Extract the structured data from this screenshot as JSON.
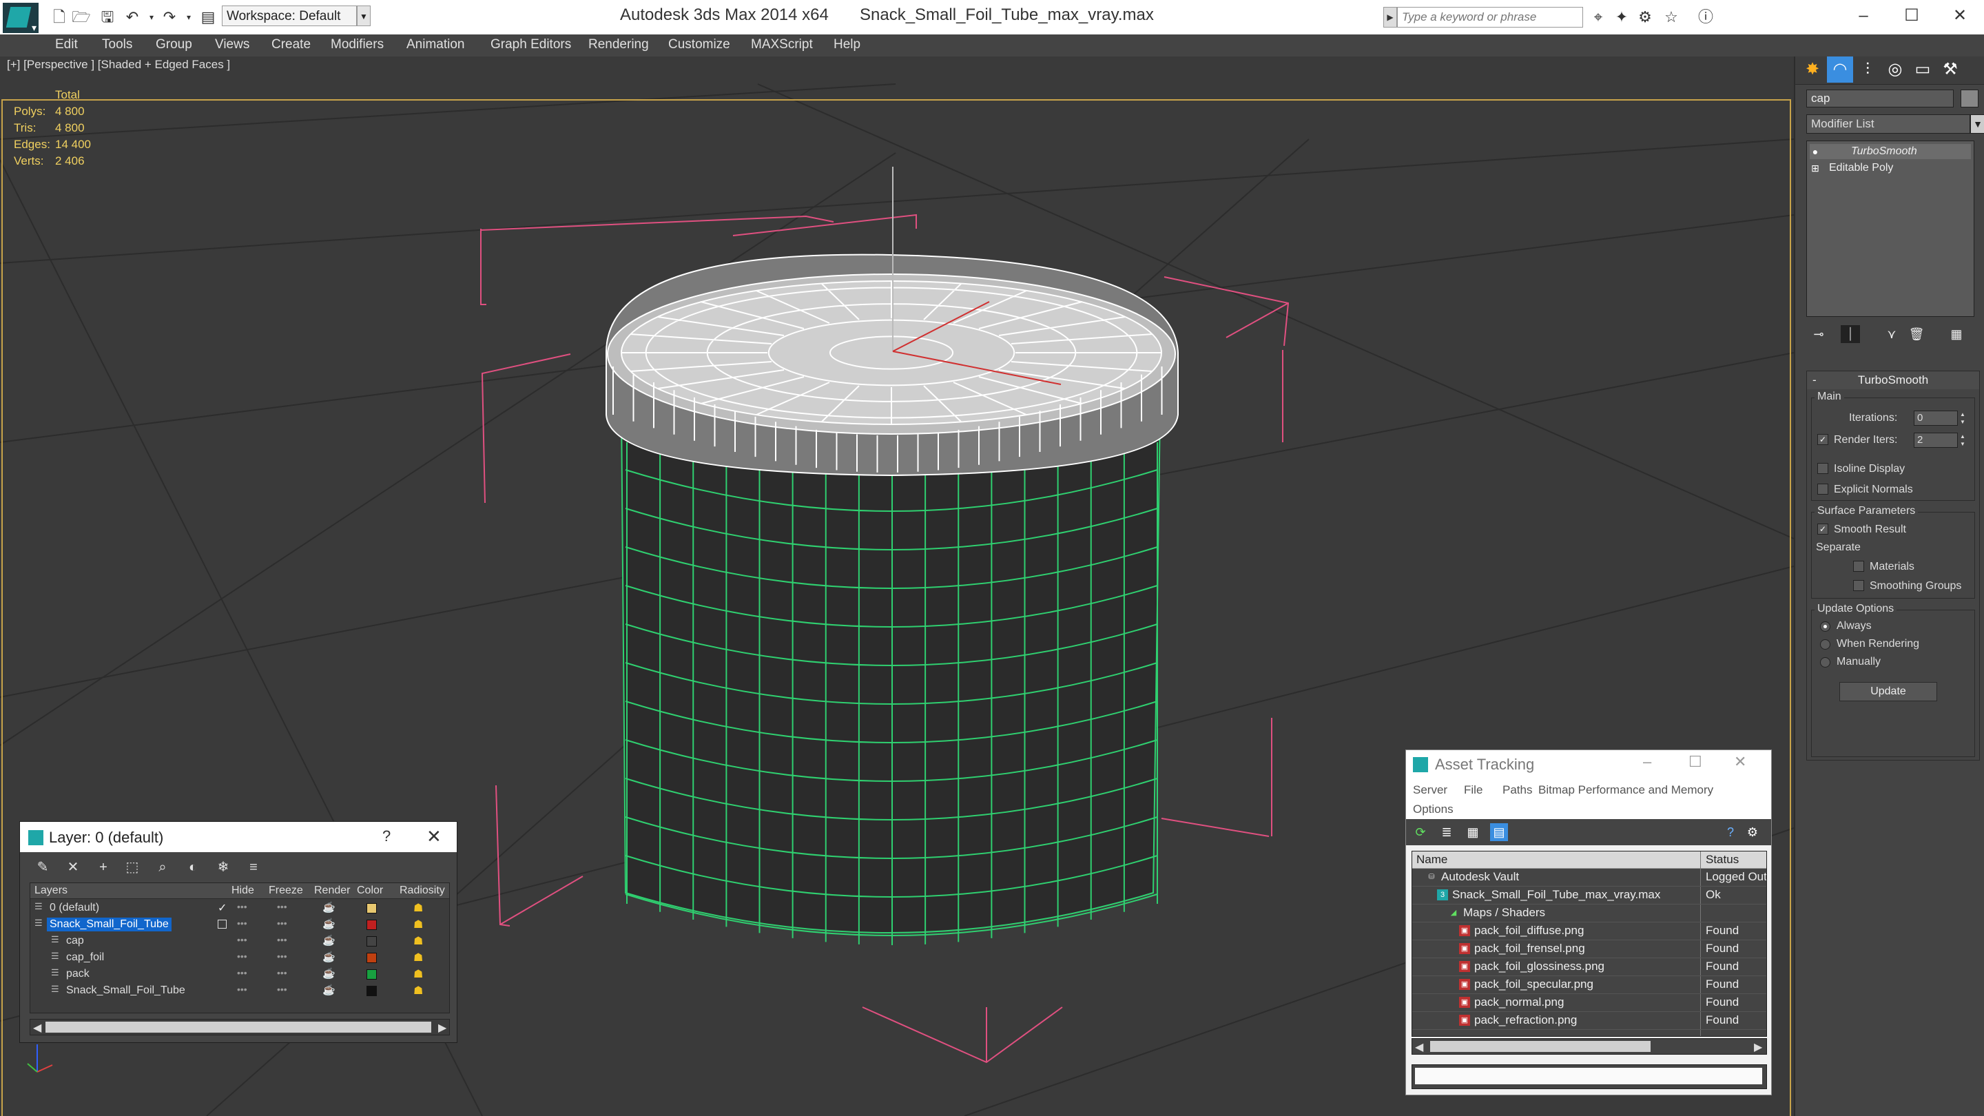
{
  "titlebar": {
    "workspace": "Workspace: Default",
    "app_title": "Autodesk 3ds Max  2014 x64",
    "file_title": "Snack_Small_Foil_Tube_max_vray.max",
    "search_placeholder": "Type a keyword or phrase"
  },
  "menu": [
    "Edit",
    "Tools",
    "Group",
    "Views",
    "Create",
    "Modifiers",
    "Animation",
    "Graph Editors",
    "Rendering",
    "Customize",
    "MAXScript",
    "Help"
  ],
  "viewport": {
    "label": "[+] [Perspective ] [Shaded + Edged Faces ]",
    "stats_header": "Total",
    "stats": [
      {
        "label": "Polys:",
        "value": "4 800"
      },
      {
        "label": "Tris:",
        "value": "4 800"
      },
      {
        "label": "Edges:",
        "value": "14 400"
      },
      {
        "label": "Verts:",
        "value": "2 406"
      }
    ],
    "colors": {
      "wire": "#ffffff",
      "body_wire": "#2fd070",
      "gizmo": "#e05080",
      "frame": "#c8a34a"
    }
  },
  "command_panel": {
    "object_name": "cap",
    "modifier_list": "Modifier List",
    "stack": [
      "TurboSmooth",
      "Editable Poly"
    ],
    "turbosmooth": {
      "title": "TurboSmooth",
      "main_group": "Main",
      "iterations_label": "Iterations:",
      "iterations": "0",
      "render_iters_label": "Render Iters:",
      "render_iters": "2",
      "isoline": "Isoline Display",
      "explicit_normals": "Explicit Normals",
      "surface_group": "Surface Parameters",
      "smooth_result": "Smooth Result",
      "separate": "Separate",
      "materials": "Materials",
      "smoothing_groups": "Smoothing Groups",
      "update_group": "Update Options",
      "always": "Always",
      "when_rendering": "When Rendering",
      "manually": "Manually",
      "update_button": "Update"
    }
  },
  "layer_dialog": {
    "title": "Layer: 0 (default)",
    "help": "?",
    "columns": [
      "Layers",
      "Hide",
      "Freeze",
      "Render",
      "Color",
      "Radiosity"
    ],
    "rows": [
      {
        "name": "0 (default)",
        "color": "#e8c870",
        "indent": 0
      },
      {
        "name": "Snack_Small_Foil_Tube",
        "color": "#c02020",
        "indent": 0,
        "selected": true
      },
      {
        "name": "cap",
        "color": "#444444",
        "indent": 1
      },
      {
        "name": "cap_foil",
        "color": "#c04010",
        "indent": 1
      },
      {
        "name": "pack",
        "color": "#18a040",
        "indent": 1
      },
      {
        "name": "Snack_Small_Foil_Tube",
        "color": "#111111",
        "indent": 1
      }
    ]
  },
  "asset_dialog": {
    "title": "Asset Tracking",
    "menus": [
      "Server",
      "File",
      "Paths",
      "Bitmap Performance and Memory",
      "Options"
    ],
    "columns": [
      "Name",
      "Status"
    ],
    "rows": [
      {
        "name": "Autodesk Vault",
        "status": "Logged Out",
        "indent": 1,
        "icon": "vault"
      },
      {
        "name": "Snack_Small_Foil_Tube_max_vray.max",
        "status": "Ok",
        "indent": 2,
        "icon": "max"
      },
      {
        "name": "Maps / Shaders",
        "status": "",
        "indent": 3,
        "icon": "maps"
      },
      {
        "name": "pack_foil_diffuse.png",
        "status": "Found",
        "indent": 4,
        "icon": "png"
      },
      {
        "name": "pack_foil_frensel.png",
        "status": "Found",
        "indent": 4,
        "icon": "png"
      },
      {
        "name": "pack_foil_glossiness.png",
        "status": "Found",
        "indent": 4,
        "icon": "png"
      },
      {
        "name": "pack_foil_specular.png",
        "status": "Found",
        "indent": 4,
        "icon": "png"
      },
      {
        "name": "pack_normal.png",
        "status": "Found",
        "indent": 4,
        "icon": "png"
      },
      {
        "name": "pack_refraction.png",
        "status": "Found",
        "indent": 4,
        "icon": "png"
      }
    ]
  }
}
